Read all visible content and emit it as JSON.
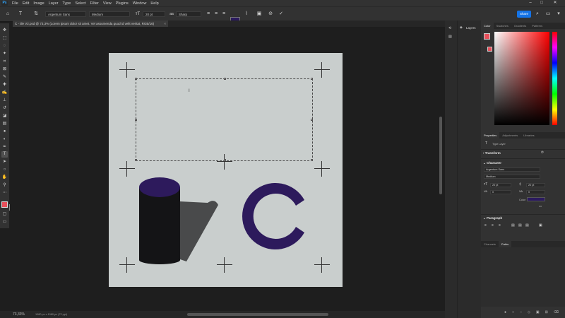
{
  "menu": {
    "logo": "Ps",
    "items": [
      "File",
      "Edit",
      "Image",
      "Layer",
      "Type",
      "Select",
      "Filter",
      "View",
      "Plugins",
      "Window",
      "Help"
    ]
  },
  "window_controls": {
    "minimize": "–",
    "maximize": "□",
    "close": "✕"
  },
  "options": {
    "font_family": "Argentum Sans",
    "font_style": "Medium",
    "font_size": "20 pt",
    "anti_alias": "Sharp",
    "text_color": "#2b1a5e",
    "share_label": "Share"
  },
  "document": {
    "tab_title": "C - tile V2.psd @ 73,3% (Lorem ipsum dolor sit amet. Vel assumenda quod id velit veritat, RGB/16)",
    "close": "×"
  },
  "status": {
    "zoom": "73,33%",
    "doc_info": "1080 px x 1080 px (72 ppi)"
  },
  "panels": {
    "layers_label": "Layers",
    "color_tabs": [
      "Color",
      "Swatches",
      "Gradients",
      "Patterns"
    ],
    "props_tabs": [
      "Properties",
      "Adjustments",
      "Libraries"
    ],
    "layer_kind": "Type Layer",
    "transform": "Transform",
    "character": "Character",
    "char_font": "Argentum Sans",
    "char_style": "Medium",
    "char_size": "20 pt",
    "char_leading": "20 pt",
    "char_kern": "0",
    "char_track": "0",
    "color_label": "Color",
    "paragraph": "Paragraph",
    "bottom_tabs": [
      "Channels",
      "Paths"
    ],
    "more": "•••"
  },
  "colors": {
    "accent": "#1473e6",
    "foreground": "#e8505b",
    "artwork_purple": "#2d1a5c",
    "cylinder_body": "#141416"
  }
}
